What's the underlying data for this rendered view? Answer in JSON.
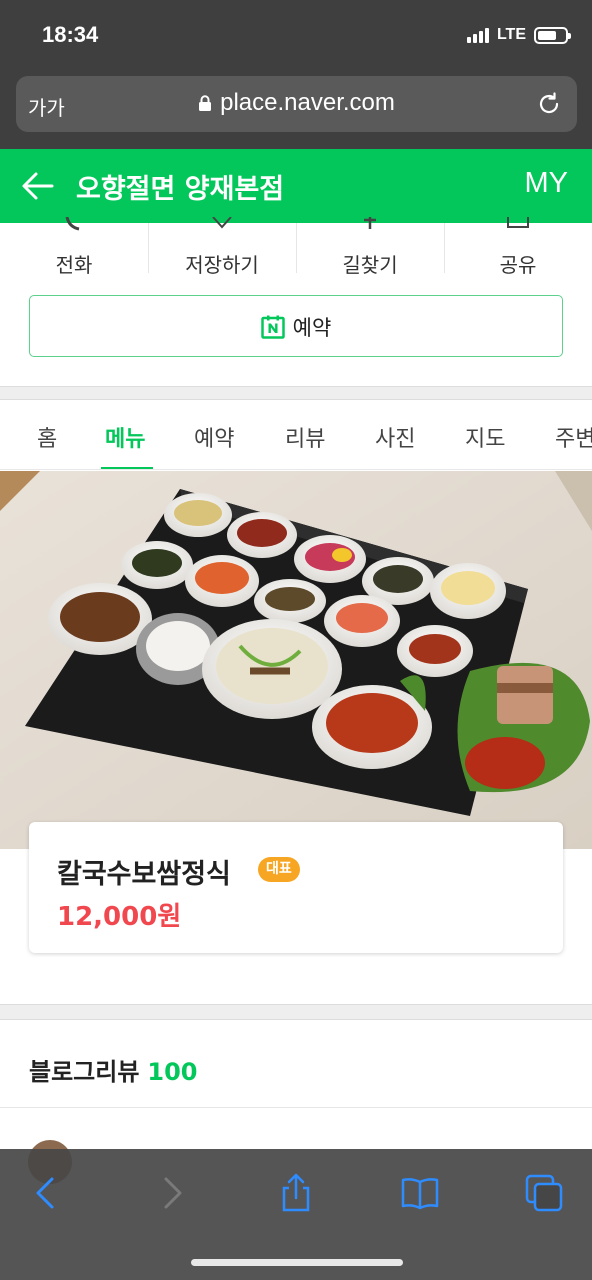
{
  "status": {
    "time": "18:34",
    "network": "LTE"
  },
  "url_bar": {
    "text_size_label": "가가",
    "url": "place.naver.com"
  },
  "header": {
    "title": "오향절면 양재본점",
    "my_label": "MY"
  },
  "actions": [
    {
      "label": "전화",
      "icon": "phone-icon"
    },
    {
      "label": "저장하기",
      "icon": "star-icon"
    },
    {
      "label": "길찾기",
      "icon": "directions-icon"
    },
    {
      "label": "공유",
      "icon": "share-icon"
    }
  ],
  "reserve_button": {
    "label": "예약",
    "icon": "naver-booking-icon"
  },
  "tabs": [
    {
      "label": "홈",
      "active": false
    },
    {
      "label": "메뉴",
      "active": true
    },
    {
      "label": "예약",
      "active": false
    },
    {
      "label": "리뷰",
      "active": false
    },
    {
      "label": "사진",
      "active": false
    },
    {
      "label": "지도",
      "active": false
    },
    {
      "label": "주변",
      "active": false
    }
  ],
  "menu": {
    "name": "칼국수보쌈정식",
    "badge": "대표",
    "price": "12,000원"
  },
  "blog_review": {
    "title": "블로그리뷰",
    "count": "100"
  },
  "colors": {
    "brand_green": "#03c75a",
    "price_red": "#f0484e",
    "badge_orange": "#f7a623",
    "ios_blue": "#2f8cff"
  }
}
